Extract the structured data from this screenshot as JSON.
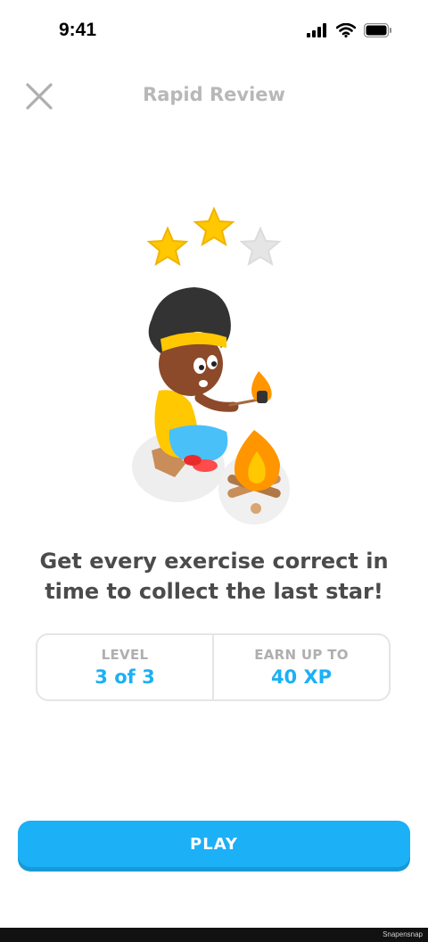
{
  "status_bar": {
    "time": "9:41"
  },
  "header": {
    "title": "Rapid Review",
    "close_icon": "close-icon"
  },
  "illustration": {
    "stars_earned": 2,
    "stars_total": 3
  },
  "message": "Get every exercise correct in time to collect the last star!",
  "info": {
    "level_label": "LEVEL",
    "level_value": "3 of 3",
    "xp_label": "EARN UP TO",
    "xp_value": "40 XP"
  },
  "play_button": {
    "label": "PLAY"
  },
  "watermark": "Snapensnap",
  "colors": {
    "primary": "#1cb0f6",
    "primary_shadow": "#1899d6",
    "title_gray": "#b8b8b8",
    "text_dark": "#4b4b4b",
    "border": "#e5e5e5",
    "star_gold": "#ffc800"
  }
}
